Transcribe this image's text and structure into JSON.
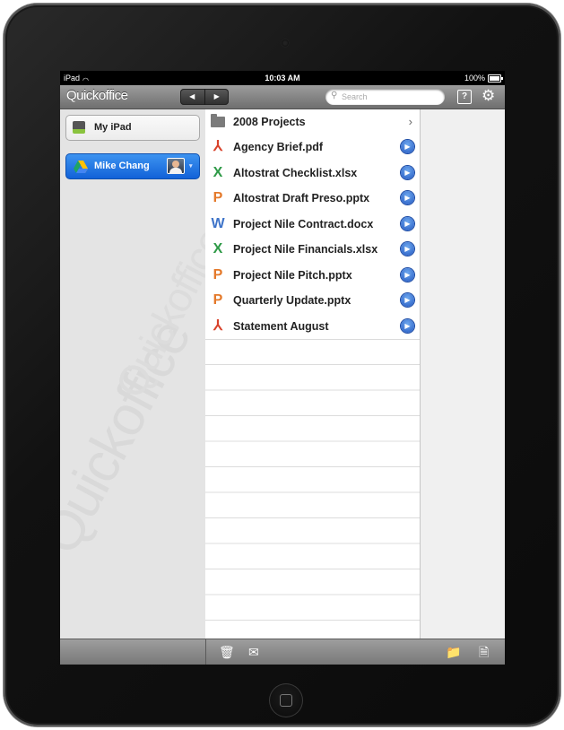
{
  "status_bar": {
    "carrier": "iPad",
    "time": "10:03 AM",
    "battery": "100%"
  },
  "toolbar": {
    "app_title": "Quickoffice",
    "back_glyph": "◀",
    "forward_glyph": "▶",
    "search_placeholder": "Search",
    "help_glyph": "?",
    "settings_glyph": "⚙"
  },
  "sidebar": {
    "locations": [
      {
        "label": "My iPad",
        "icon": "hard-drive-icon"
      },
      {
        "label": "Mike Chang",
        "icon": "google-drive-icon",
        "selected": true
      }
    ],
    "watermark": "Quickoffice"
  },
  "files": [
    {
      "name": "2008 Projects",
      "type": "folder",
      "icon_glyph": "",
      "color": "#7b7b7b"
    },
    {
      "name": "Agency Brief.pdf",
      "type": "pdf",
      "icon_glyph": "⅄",
      "color": "#d9422b"
    },
    {
      "name": "Altostrat Checklist.xlsx",
      "type": "xlsx",
      "icon_glyph": "X",
      "color": "#2e9a47"
    },
    {
      "name": "Altostrat Draft Preso.pptx",
      "type": "pptx",
      "icon_glyph": "P",
      "color": "#e4792a"
    },
    {
      "name": "Project Nile Contract.docx",
      "type": "docx",
      "icon_glyph": "W",
      "color": "#3f74c9"
    },
    {
      "name": "Project Nile Financials.xlsx",
      "type": "xlsx",
      "icon_glyph": "X",
      "color": "#2e9a47"
    },
    {
      "name": "Project Nile Pitch.pptx",
      "type": "pptx",
      "icon_glyph": "P",
      "color": "#e4792a"
    },
    {
      "name": "Quarterly Update.pptx",
      "type": "pptx",
      "icon_glyph": "P",
      "color": "#e4792a"
    },
    {
      "name": "Statement August",
      "type": "pdf",
      "icon_glyph": "⅄",
      "color": "#d9422b"
    }
  ],
  "bottom_bar": {
    "trash_glyph": "🗑",
    "mail_glyph": "✉",
    "new_folder_glyph": "📁",
    "new_file_glyph": "🗎"
  }
}
